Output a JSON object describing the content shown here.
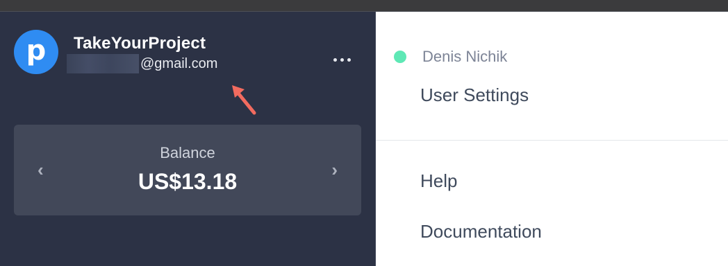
{
  "account": {
    "avatar_letter": "p",
    "org_name": "TakeYourProject",
    "email_domain": "@gmail.com"
  },
  "balance": {
    "label": "Balance",
    "value": "US$13.18",
    "prev_icon": "‹",
    "next_icon": "›"
  },
  "dropdown": {
    "user_name": "Denis Nichik",
    "status": "online",
    "items": [
      {
        "label": "User Settings"
      },
      {
        "label": "Help"
      },
      {
        "label": "Documentation"
      }
    ]
  },
  "colors": {
    "sidebar_bg": "#2c3245",
    "avatar_bg": "#2f8cf2",
    "status_online": "#5ee8b5",
    "annotation_arrow": "#f26b5f",
    "card_bg": "#424859"
  },
  "icons": {
    "more": "more-horizontal-icon",
    "annotation": "annotation-arrow-icon"
  }
}
